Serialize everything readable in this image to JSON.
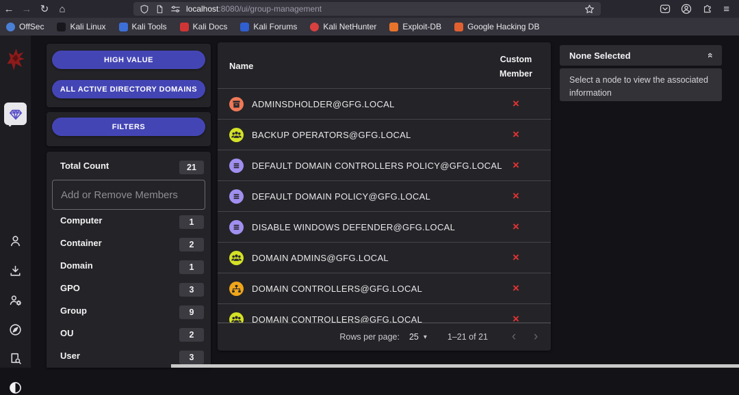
{
  "browser": {
    "back_icon": "←",
    "forward_icon": "→",
    "reload_icon": "↻",
    "home_icon": "⌂",
    "menu_icon": "≡",
    "url": {
      "host": "localhost",
      "rest": ":8080/ui/group-management"
    },
    "bookmarks": [
      {
        "label": "OffSec",
        "color": "#4a7fd6"
      },
      {
        "label": "Kali Linux",
        "color": "#17171c"
      },
      {
        "label": "Kali Tools",
        "color": "#3d6fd8"
      },
      {
        "label": "Kali Docs",
        "color": "#d03535"
      },
      {
        "label": "Kali Forums",
        "color": "#2f5fd0"
      },
      {
        "label": "Kali NetHunter",
        "color": "#d84040"
      },
      {
        "label": "Exploit-DB",
        "color": "#e8742c"
      },
      {
        "label": "Google Hacking DB",
        "color": "#e06030"
      }
    ]
  },
  "sidebar": {
    "icons": [
      "bloodhound-logo",
      "chart",
      "group-management-gem",
      "person",
      "download",
      "administration",
      "compass",
      "api-explorer",
      "dark-mode-toggle"
    ]
  },
  "left_panel": {
    "button_color": "#4445b5",
    "high_value_button": "HIGH VALUE",
    "all_domains_button": "ALL ACTIVE DIRECTORY DOMAINS",
    "filters_button": "FILTERS",
    "total_count_label": "Total Count",
    "total_count": "21",
    "member_input_placeholder": "Add or Remove Members",
    "counts": [
      {
        "label": "Computer",
        "value": "1"
      },
      {
        "label": "Container",
        "value": "2"
      },
      {
        "label": "Domain",
        "value": "1"
      },
      {
        "label": "GPO",
        "value": "3"
      },
      {
        "label": "Group",
        "value": "9"
      },
      {
        "label": "OU",
        "value": "2"
      },
      {
        "label": "User",
        "value": "3"
      }
    ]
  },
  "table": {
    "columns": {
      "name": "Name",
      "custom_member": "Custom Member"
    },
    "x_glyph": "×",
    "x_color": "#e23434",
    "rows": [
      {
        "name": "ADMINSDHOLDER@GFG.LOCAL",
        "icon": "container-icon",
        "color": "#f07857"
      },
      {
        "name": "BACKUP OPERATORS@GFG.LOCAL",
        "icon": "group-icon",
        "color": "#d4e226"
      },
      {
        "name": "DEFAULT DOMAIN CONTROLLERS POLICY@GFG.LOCAL",
        "icon": "gpo-icon",
        "color": "#a18ff0"
      },
      {
        "name": "DEFAULT DOMAIN POLICY@GFG.LOCAL",
        "icon": "gpo-icon",
        "color": "#a18ff0"
      },
      {
        "name": "DISABLE WINDOWS DEFENDER@GFG.LOCAL",
        "icon": "gpo-icon",
        "color": "#a18ff0"
      },
      {
        "name": "DOMAIN ADMINS@GFG.LOCAL",
        "icon": "group-icon",
        "color": "#d4e226"
      },
      {
        "name": "DOMAIN CONTROLLERS@GFG.LOCAL",
        "icon": "ou-icon",
        "color": "#f0a51a"
      },
      {
        "name": "DOMAIN CONTROLLERS@GFG.LOCAL",
        "icon": "group-icon",
        "color": "#d4e226"
      }
    ],
    "footer": {
      "rows_per_page_label": "Rows per page:",
      "rows_per_page": "25",
      "caret": "▾",
      "range_label": "1–21 of 21",
      "prev_icon": "‹",
      "next_icon": "›"
    }
  },
  "right_panel": {
    "header": "None Selected",
    "collapse_glyph": "«",
    "info_text": "Select a node to view the associated information"
  }
}
